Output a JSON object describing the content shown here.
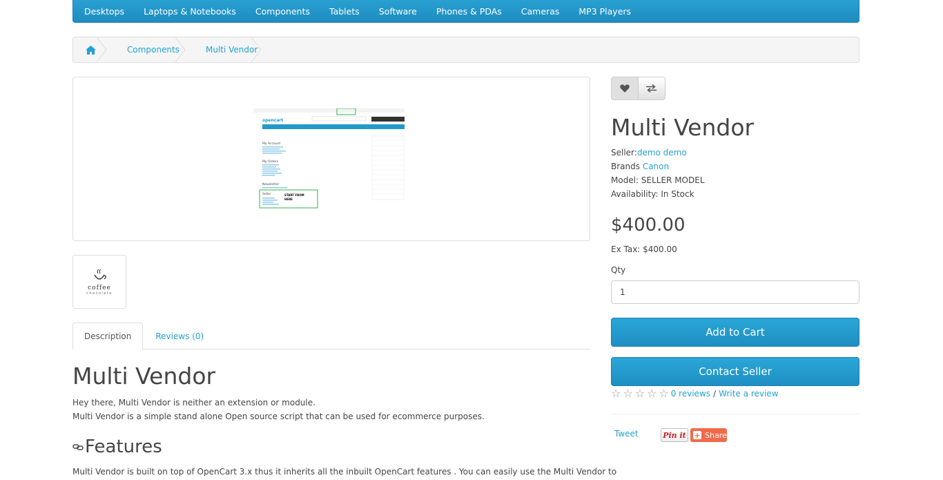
{
  "nav": {
    "items": [
      "Desktops",
      "Laptops & Notebooks",
      "Components",
      "Tablets",
      "Software",
      "Phones & PDAs",
      "Cameras",
      "MP3 Players"
    ]
  },
  "breadcrumb": {
    "home_icon": "home-icon",
    "items": [
      "Components",
      "Multi Vendor"
    ]
  },
  "image": {
    "screenshot_texts": {
      "logo": "opencart",
      "my_account": "My Account",
      "my_orders": "My Orders",
      "newsletter": "Newsletter",
      "seller": "Seller",
      "start_from": "START FROM",
      "here": "HERE"
    },
    "thumb_word": "coffee",
    "thumb_sub": "chocolate"
  },
  "tabs": {
    "description": "Description",
    "reviews": "Reviews (0)"
  },
  "description": {
    "title": "Multi Vendor",
    "line1": "Hey there, Multi Vendor is neither an extension or module.",
    "line2": "Multi Vendor is a simple stand alone Open source script that can be used for ecommerce purposes.",
    "features_heading": "Features",
    "features_line": "Multi Vendor is built on top of OpenCart 3.x thus it inherits all the inbuilt OpenCart features . You can easily use the Multi Vendor to"
  },
  "product": {
    "wishlist_icon": "heart-icon",
    "compare_icon": "exchange-icon",
    "title": "Multi Vendor",
    "seller_label": "Seller:",
    "seller_name": "demo demo",
    "brand_label": "Brands",
    "brand_name": "Canon",
    "model": "Model: SELLER MODEL",
    "availability": "Availability: In Stock",
    "price": "$400.00",
    "ex_tax": "Ex Tax: $400.00",
    "qty_label": "Qty",
    "qty_value": "1",
    "add_to_cart": "Add to Cart",
    "contact_seller": "Contact Seller",
    "rating": 0,
    "reviews_link": "0 reviews",
    "separator": "/",
    "write_review": "Write a review",
    "tweet": "Tweet",
    "pin_it": "Pin it",
    "share": "Share"
  },
  "colors": {
    "accent": "#23a1d1",
    "button": "#229ac8",
    "share": "#f26a4b",
    "pin": "#cb2027"
  }
}
